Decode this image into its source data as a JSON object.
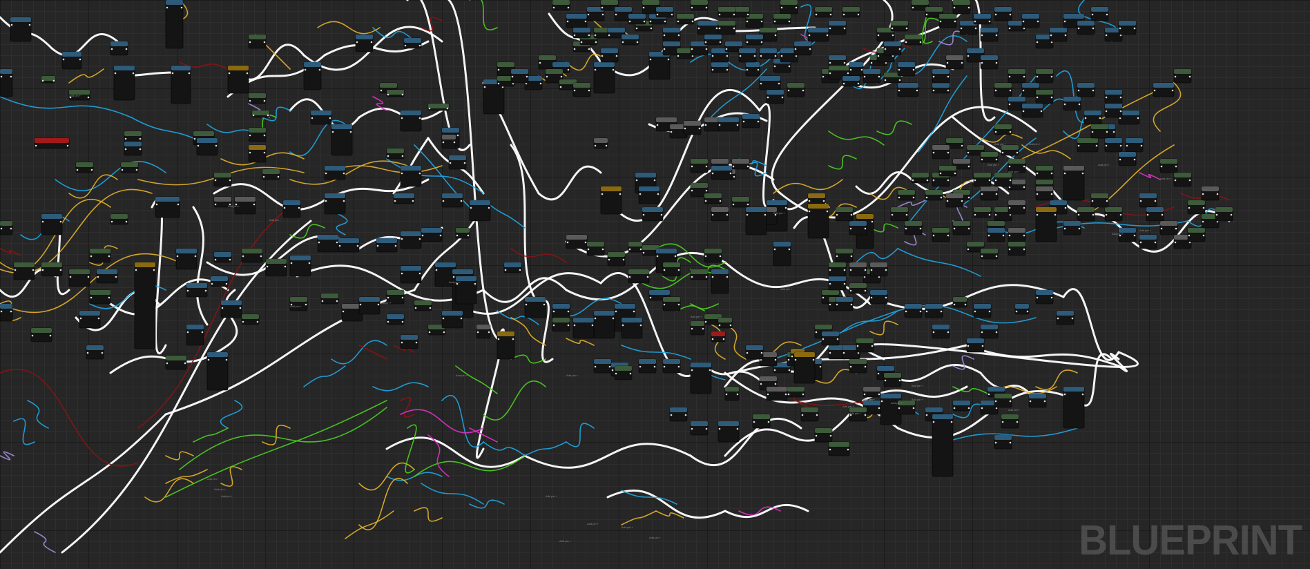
{
  "editor": {
    "watermark": "BLUEPRINT",
    "colors": {
      "background": "#262626",
      "grid_minor": "#2e2e2e",
      "grid_major": "#1b1b1b",
      "exec_wire": "#ffffff",
      "wire_blue": "#1fa7e6",
      "wire_green": "#4cd21f",
      "wire_yellow": "#e6b32a",
      "wire_red": "#8b1414",
      "wire_pink": "#e033c7",
      "wire_lavender": "#a48fe0",
      "node_header_blue": "#2e5b7a",
      "node_header_green": "#3d5a3a",
      "node_header_gray": "#5a5a5a",
      "node_header_red": "#a11a1a",
      "node_header_gold": "#8a6a10",
      "node_body": "#141414"
    },
    "node_label": "Add pin +"
  }
}
